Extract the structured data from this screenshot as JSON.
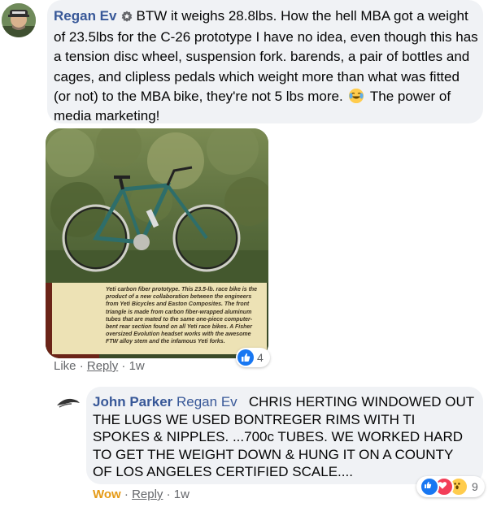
{
  "comment1": {
    "author": "Regan Ev",
    "text_part1": "BTW it weighs 28.8lbs. How the hell MBA got a weight of 23.5lbs for the C-26 prototype I have no idea, even though this has a tension disc wheel, suspension fork. barends, a pair of bottles and cages, and clipless pedals which weight more than what was fitted (or not) to the MBA bike, they're not 5 lbs more.",
    "text_part2": "The power of media marketing!",
    "photo_caption": "Yeti carbon fiber prototype. This 23.5-lb. race bike is the product of a new collaboration between the engineers from Yeti Bicycles and Easton Composites. The front triangle is made from carbon fiber-wrapped aluminum tubes that are mated to the same one-piece computer-bent rear section found on all Yeti race bikes. A Fisher oversized Evolution headset works with the awesome FTW alloy stem and the infamous Yeti forks.",
    "like_label": "Like",
    "reply_label": "Reply",
    "time": "1w",
    "reaction_count": "4",
    "separator": "·"
  },
  "comment2": {
    "author": "John Parker",
    "mention": "Regan Ev",
    "text": "CHRIS HERTING WINDOWED OUT THE LUGS WE USED BONTREGER RIMS WITH TI SPOKES & NIPPLES. ...700c TUBES. WE WORKED HARD TO GET THE WEIGHT DOWN & HUNG IT ON A COUNTY OF LOS ANGELES CERTIFIED SCALE....",
    "wow_label": "Wow",
    "reply_label": "Reply",
    "time": "1w",
    "reaction_count": "9",
    "separator": "·"
  },
  "colors": {
    "link": "#385898",
    "meta": "#65676b",
    "bubble": "#f0f2f5",
    "wow": "#e59a16",
    "like_blue": "#1877f2",
    "love_red": "#f33e58"
  },
  "icons": [
    "top-fan-badge-icon",
    "laughing-emoji-icon",
    "like-reaction-icon",
    "love-reaction-icon",
    "wow-reaction-icon"
  ]
}
